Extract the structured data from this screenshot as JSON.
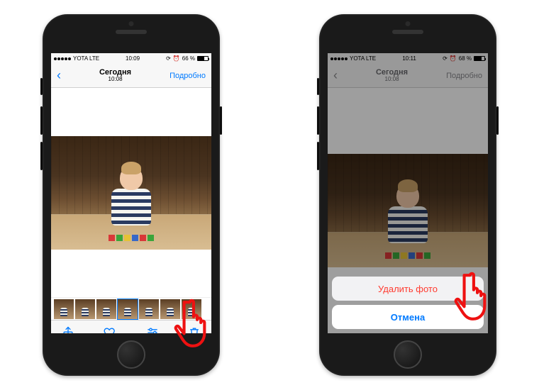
{
  "left": {
    "status": {
      "carrier": "YOTA  LTE",
      "time": "10:09",
      "battery_text": "66 %"
    },
    "nav": {
      "title": "Сегодня",
      "subtitle": "10:08",
      "detail": "Подробно"
    },
    "toolbar": {
      "share_icon": "share-icon",
      "favorite_icon": "heart-icon",
      "edit_icon": "sliders-icon",
      "delete_icon": "trash-icon"
    }
  },
  "right": {
    "status": {
      "carrier": "YOTA  LTE",
      "time": "10:11",
      "battery_text": "68 %"
    },
    "nav": {
      "title": "Сегодня",
      "subtitle": "10:08",
      "detail": "Подробно"
    },
    "sheet": {
      "delete_label": "Удалить фото",
      "cancel_label": "Отмена"
    }
  },
  "colors": {
    "tint": "#007aff",
    "destructive": "#ff3b30"
  }
}
